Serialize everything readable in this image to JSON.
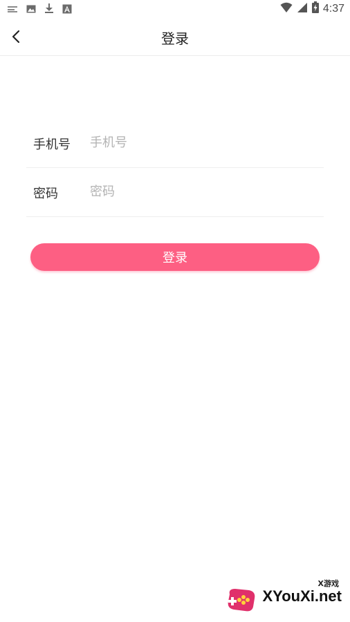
{
  "status_bar": {
    "time": "4:37",
    "left_icons": [
      "sim-icon",
      "image-icon",
      "download-icon",
      "a-icon"
    ],
    "right_icons": [
      "wifi-icon",
      "signal-icon",
      "battery-icon"
    ]
  },
  "header": {
    "title": "登录",
    "back_icon": "chevron-left-icon"
  },
  "form": {
    "phone": {
      "label": "手机号",
      "placeholder": "手机号",
      "value": ""
    },
    "password": {
      "label": "密码",
      "placeholder": "密码",
      "value": ""
    }
  },
  "login_button": {
    "label": "登录"
  },
  "watermark": {
    "tag": "X游戏",
    "site": "XYouXi.net"
  },
  "colors": {
    "accent": "#fd5f83",
    "text": "#333333",
    "placeholder": "#b3b3b3"
  }
}
